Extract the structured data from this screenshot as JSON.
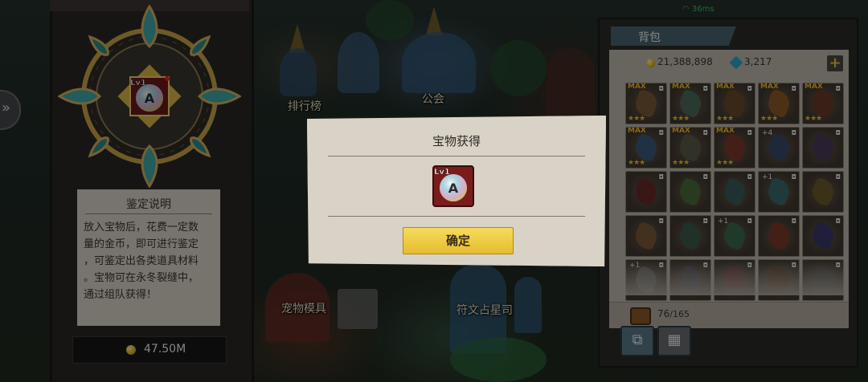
{
  "status_bar": {
    "ping": "36ms"
  },
  "town": {
    "buildings": [
      {
        "label": "排行榜"
      },
      {
        "label": "公会"
      },
      {
        "label": "宠物模具"
      },
      {
        "label": "符文占星司"
      }
    ]
  },
  "appraisal_panel": {
    "slot_item": {
      "level": "Lv1",
      "letter": "A"
    },
    "description_title": "鉴定说明",
    "description_lines": [
      "放入宝物后，花费一定数",
      "量的金币，即可进行鉴定",
      "，可鉴定出各类道具材料",
      "。宝物可在永冬裂缝中，",
      "通过组队获得！"
    ],
    "cost": "47.50M"
  },
  "bag_panel": {
    "title": "背包",
    "gold": "21,388,898",
    "gems": "3,217",
    "add_button": "+",
    "max_badge": "MAX",
    "capacity_used": "76",
    "capacity_max": "/165",
    "slots": [
      {
        "max": true,
        "stars": 3,
        "plus": "",
        "hue": "#7a5a3a"
      },
      {
        "max": true,
        "stars": 3,
        "plus": "",
        "hue": "#4a6a5a"
      },
      {
        "max": true,
        "stars": 3,
        "plus": "",
        "hue": "#6a4a2a"
      },
      {
        "max": true,
        "stars": 3,
        "plus": "",
        "hue": "#8a5a2a"
      },
      {
        "max": true,
        "stars": 3,
        "plus": "",
        "hue": "#6a3a2a"
      },
      {
        "max": true,
        "stars": 3,
        "plus": "",
        "hue": "#3a5a7a"
      },
      {
        "max": true,
        "stars": 3,
        "plus": "",
        "hue": "#5a5a4a"
      },
      {
        "max": true,
        "stars": 3,
        "plus": "",
        "hue": "#7a3a2a"
      },
      {
        "max": false,
        "stars": 0,
        "plus": "+4",
        "hue": "#3a4a6a"
      },
      {
        "max": false,
        "stars": 0,
        "plus": "",
        "hue": "#4a3a5a"
      },
      {
        "max": false,
        "stars": 0,
        "plus": "",
        "hue": "#6a2a2a"
      },
      {
        "max": false,
        "stars": 0,
        "plus": "",
        "hue": "#4a6a3a"
      },
      {
        "max": false,
        "stars": 0,
        "plus": "",
        "hue": "#3a5a5a"
      },
      {
        "max": false,
        "stars": 0,
        "plus": "+1",
        "hue": "#3a6a6a"
      },
      {
        "max": false,
        "stars": 0,
        "plus": "",
        "hue": "#6a5a2a"
      },
      {
        "max": false,
        "stars": 0,
        "plus": "",
        "hue": "#7a5a3a"
      },
      {
        "max": false,
        "stars": 0,
        "plus": "",
        "hue": "#3a5a4a"
      },
      {
        "max": false,
        "stars": 0,
        "plus": "+1",
        "hue": "#3a6a4a"
      },
      {
        "max": false,
        "stars": 0,
        "plus": "",
        "hue": "#7a3a2a"
      },
      {
        "max": false,
        "stars": 0,
        "plus": "",
        "hue": "#3a3a6a"
      },
      {
        "max": false,
        "stars": 0,
        "plus": "+1",
        "hue": "#6a6a6a"
      },
      {
        "max": false,
        "stars": 0,
        "plus": "",
        "hue": "#4a4a5a"
      },
      {
        "max": false,
        "stars": 0,
        "plus": "",
        "hue": "#6a3a3a"
      },
      {
        "max": false,
        "stars": 0,
        "plus": "",
        "hue": "#5a3a2a"
      },
      {
        "max": false,
        "stars": 0,
        "plus": "",
        "hue": "#4a4a4a"
      }
    ],
    "buttons": [
      {
        "icon": "toolbox-icon",
        "glyph": "⧉"
      },
      {
        "icon": "basket-icon",
        "glyph": "▦"
      }
    ]
  },
  "modal": {
    "title": "宝物获得",
    "reward": {
      "level": "Lv1",
      "letter": "A"
    },
    "confirm_label": "确定"
  },
  "colors": {
    "panel_paper": "#d9d2c6",
    "confirm_button": "#f0cc40",
    "max_badge": "#f3c030",
    "bag_tab": "#4a6470"
  }
}
